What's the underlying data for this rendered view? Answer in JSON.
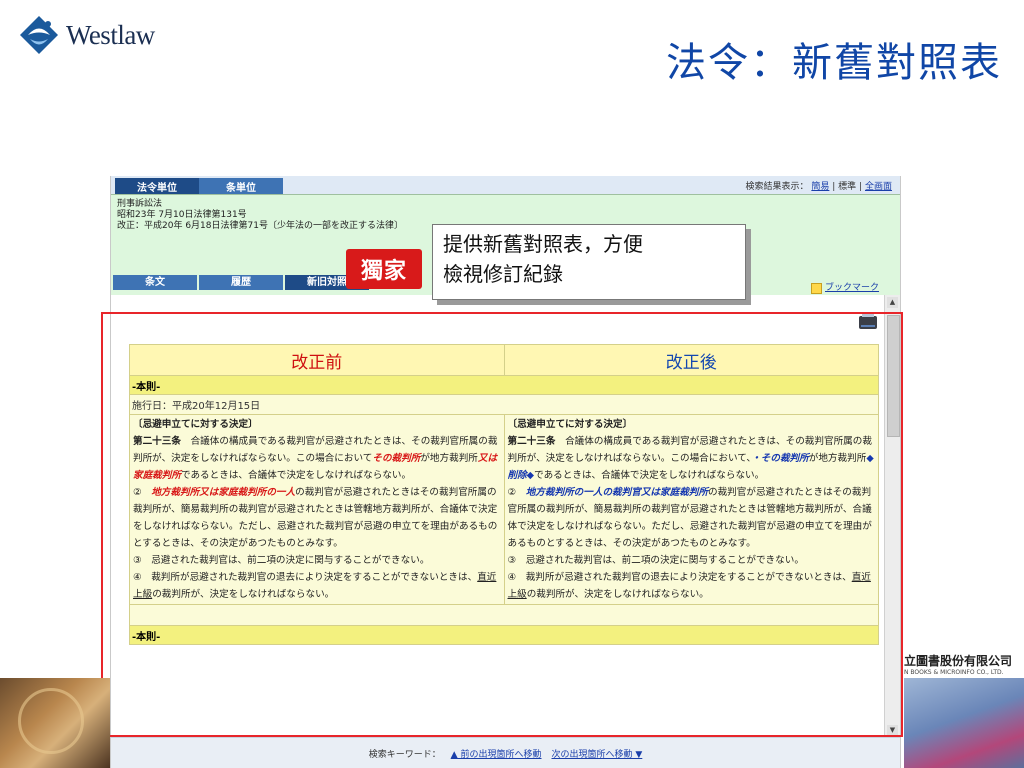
{
  "slide": {
    "logo_text": "Westlaw",
    "title": "法令：新舊對照表",
    "callout_line1": "提供新舊對照表，方便",
    "callout_line2": "檢視修訂紀錄",
    "company_cn": "立圖書股份有限公司",
    "company_en": "N BOOKS & MICROINFO CO., LTD."
  },
  "app": {
    "tabs": [
      {
        "label": "法令単位",
        "active": true
      },
      {
        "label": "条単位",
        "active": false
      }
    ],
    "result_display": {
      "label": "検索結果表示：",
      "options": [
        "簡易",
        "標準",
        "全画面"
      ],
      "separator": "|"
    },
    "law": {
      "name": "刑事訴訟法",
      "enacted": "昭和23年 7月10日法律第131号",
      "amended": "改正：平成20年 6月18日法律第71号〔少年法の一部を改正する法律〕"
    },
    "subtabs": [
      "条文",
      "履歴",
      "新旧対照"
    ],
    "badge": "獨家",
    "bookmark": "ブックマーク",
    "compare": {
      "header_before": "改正前",
      "header_after": "改正後",
      "section": "-本則-",
      "effective_date": "施行日：平成20年12月15日",
      "section_bottom": "-本則-",
      "before": {
        "heading": "〔忌避申立てに対する決定〕",
        "art_num": "第二十三条",
        "p1_a": "合議体の構成員である裁判官が忌避されたときは、その裁判官所属の裁判所が、決定をしなければならない。この場合において",
        "p1_red1": "その裁判所",
        "p1_b": "が地方裁判所",
        "p1_red2": "又は家庭裁判所",
        "p1_c": "であるときは、合議体で決定をしなければならない。",
        "p2_num": "②",
        "p2_red": "地方裁判所又は家庭裁判所の一人",
        "p2_rest": "の裁判官が忌避されたときはその裁判官所属の裁判所が、簡易裁判所の裁判官が忌避されたときは管轄地方裁判所が、合議体で決定をしなければならない。ただし、忌避された裁判官が忌避の申立てを理由があるものとするときは、その決定があつたものとみなす。",
        "p3": "③　忌避された裁判官は、前二項の決定に関与することができない。",
        "p4_a": "④　裁判所が忌避された裁判官の退去により決定をすることができないときは、",
        "p4_link": "直近上級",
        "p4_b": "の裁判所が、決定をしなければならない。"
      },
      "after": {
        "heading": "〔忌避申立てに対する決定〕",
        "art_num": "第二十三条",
        "p1_a": "合議体の構成員である裁判官が忌避されたときは、その裁判官所属の裁判所が、決定をしなければならない。この場合において、",
        "p1_blue1": "・その裁判所",
        "p1_b": "が地方裁判所",
        "p1_blue2": "◆削除◆",
        "p1_c": "であるときは、合議体で決定をしなければならない。",
        "p2_num": "②",
        "p2_blue": "地方裁判所の一人の裁判官又は家庭裁判所",
        "p2_rest": "の裁判官が忌避されたときはその裁判官所属の裁判所が、簡易裁判所の裁判官が忌避されたときは管轄地方裁判所が、合議体で決定をしなければならない。ただし、忌避された裁判官が忌避の申立てを理由があるものとするときは、その決定があつたものとみなす。",
        "p3": "③　忌避された裁判官は、前二項の決定に関与することができない。",
        "p4_a": "④　裁判所が忌避された裁判官の退去により決定をすることができないときは、",
        "p4_link": "直近上級",
        "p4_b": "の裁判所が、決定をしなければならない。"
      }
    },
    "footer": {
      "label": "検索キーワード：",
      "prev": "▲ 前の出現箇所へ移動",
      "next": "次の出現箇所へ移動 ▼"
    }
  },
  "colors": {
    "title_blue": "#1046a6",
    "tab_active": "#1e4b87",
    "highlight_red": "#e8252a",
    "badge_red": "#d81a1a"
  }
}
